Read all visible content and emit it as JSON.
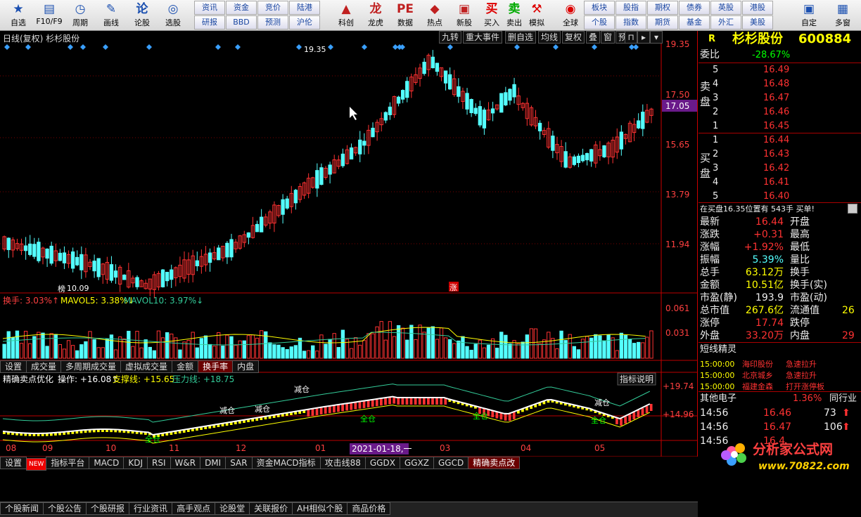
{
  "toolbar": {
    "items": [
      {
        "label": "自选",
        "icon": "star-icon"
      },
      {
        "label": "F10/F9",
        "icon": "f10-icon"
      },
      {
        "label": "周期",
        "icon": "clock-icon"
      },
      {
        "label": "画线",
        "icon": "pen-icon"
      },
      {
        "label": "论股",
        "icon": "chat-icon"
      },
      {
        "label": "选股",
        "icon": "scan-icon"
      }
    ],
    "grid1": [
      "资讯",
      "资金",
      "竞价",
      "陆港",
      "研报",
      "BBD",
      "预测",
      "沪伦"
    ],
    "items2": [
      {
        "label": "科创",
        "icon": "science-icon"
      },
      {
        "label": "龙虎",
        "icon": "dragon-icon"
      },
      {
        "label": "数据",
        "icon": "pe-icon"
      },
      {
        "label": "热点",
        "icon": "hot-icon"
      },
      {
        "label": "新股",
        "icon": "ipo-icon"
      }
    ],
    "trade": [
      {
        "label": "买入",
        "icon": "buy-icon"
      },
      {
        "label": "卖出",
        "icon": "sell-icon"
      },
      {
        "label": "模拟",
        "icon": "hammer-icon"
      },
      {
        "label": "全球",
        "icon": "globe-icon"
      }
    ],
    "grid2": [
      "板块",
      "股指",
      "期权",
      "债券",
      "英股",
      "港股",
      "个股",
      "指数",
      "期货",
      "基金",
      "外汇",
      "美股"
    ],
    "right": [
      {
        "label": "自定"
      },
      {
        "label": "多窗"
      }
    ]
  },
  "chart_header": {
    "title": "日线(复权)  杉杉股份",
    "buttons": [
      "九转",
      "重大事件",
      "删自选",
      "均线",
      "复权",
      "叠",
      "窗",
      "预测"
    ]
  },
  "price_axis": [
    "19.35",
    "17.50",
    "17.05",
    "15.65",
    "13.79",
    "11.94"
  ],
  "price_annotations": {
    "high": "19.35",
    "low": "10.09",
    "low_tag": "榜",
    "zhang": "涨"
  },
  "volume": {
    "label": "换手: 3.03%↑",
    "mavol5": "MAVOL5: 3.38%↓",
    "mavol10": "MAVOL10: 3.97%↓",
    "axis": [
      "0.061",
      "0.031"
    ]
  },
  "tabs1": [
    "设置",
    "成交量",
    "多周期成交量",
    "虚拟成交量",
    "金额",
    "换手率",
    "内盘"
  ],
  "indicator": {
    "name": "精确卖点优化",
    "op": "操作: +16.08↑",
    "support": "支撑线: +15.65",
    "pressure": "压力线: +18.75",
    "explain": "指标说明",
    "axis": [
      "+19.74",
      "+14.96"
    ],
    "labels": [
      "减仓",
      "减仓",
      "减仓",
      "全仓",
      "全仓",
      "全仓",
      "全仓",
      "减仓"
    ]
  },
  "date_axis": [
    "08",
    "09",
    "10",
    "11",
    "12",
    "01",
    "03",
    "04",
    "05"
  ],
  "date_cursor": "2021-01-18,一",
  "tabs2": [
    "设置",
    "NEW",
    "指标平台",
    "MACD",
    "KDJ",
    "RSI",
    "W&R",
    "DMI",
    "SAR",
    "资金MACD指标",
    "攻击线88",
    "GGDX",
    "GGXZ",
    "GGCD",
    "精确卖点改"
  ],
  "bottom_tabs": [
    "个股新闻",
    "个股公告",
    "个股研报",
    "行业资讯",
    "高手观点",
    "论股堂",
    "关联报价",
    "AH相似个股",
    "商品价格"
  ],
  "quote": {
    "r": "R",
    "name": "杉杉股份",
    "code": "600884",
    "weibi_label": "委比",
    "weibi": "-28.67%",
    "sell_label": "卖盘",
    "buy_label": "买盘",
    "asks": [
      {
        "lv": "5",
        "p": "16.49"
      },
      {
        "lv": "4",
        "p": "16.48"
      },
      {
        "lv": "3",
        "p": "16.47"
      },
      {
        "lv": "2",
        "p": "16.46"
      },
      {
        "lv": "1",
        "p": "16.45"
      }
    ],
    "bids": [
      {
        "lv": "1",
        "p": "16.44"
      },
      {
        "lv": "2",
        "p": "16.43"
      },
      {
        "lv": "3",
        "p": "16.42"
      },
      {
        "lv": "4",
        "p": "16.41"
      },
      {
        "lv": "5",
        "p": "16.40"
      }
    ],
    "note": "在买盘16.35位置有  543手  买单!",
    "stats": [
      {
        "l": "最新",
        "v": "16.44",
        "c": "red",
        "r": "开盘"
      },
      {
        "l": "涨跌",
        "v": "+0.31",
        "c": "red",
        "r": "最高"
      },
      {
        "l": "涨幅",
        "v": "+1.92%",
        "c": "red",
        "r": "最低"
      },
      {
        "l": "振幅",
        "v": "5.39%",
        "c": "cyan",
        "r": "量比"
      },
      {
        "l": "总手",
        "v": "63.12万",
        "c": "yellow",
        "r": "换手"
      },
      {
        "l": "金额",
        "v": "10.51亿",
        "c": "yellow",
        "r": "换手(实)"
      },
      {
        "l": "市盈(静)",
        "v": "193.9",
        "c": "white",
        "r": "市盈(动)"
      },
      {
        "l": "总市值",
        "v": "267.6亿",
        "c": "yellow",
        "r": "流通值",
        "rv": "26"
      },
      {
        "l": "涨停",
        "v": "17.74",
        "c": "red",
        "r": "跌停"
      },
      {
        "l": "外盘",
        "v": "33.20万",
        "c": "red",
        "r": "内盘",
        "rv": "29"
      }
    ],
    "short_title": "短线精灵",
    "short": [
      {
        "t": "15:00:00",
        "s": "海印股份",
        "e": "急速拉升"
      },
      {
        "t": "15:00:00",
        "s": "北京城乡",
        "e": "急速拉升"
      },
      {
        "t": "15:00:00",
        "s": "福建金森",
        "e": "打开涨停板"
      }
    ],
    "sector": "其他电子",
    "sector_pct": "1.36%",
    "sector_btn": "同行业",
    "ticks": [
      {
        "t": "14:56",
        "p": "16.46",
        "v": "73"
      },
      {
        "t": "14:56",
        "p": "16.47",
        "v": "106"
      },
      {
        "t": "14:56",
        "p": "16.4",
        "v": ""
      }
    ]
  },
  "watermark": {
    "text": "分析家公式网",
    "url": "www.70822.com"
  },
  "colors": {
    "up": "#ff3232",
    "down": "#54ffff",
    "bg": "#000000"
  }
}
